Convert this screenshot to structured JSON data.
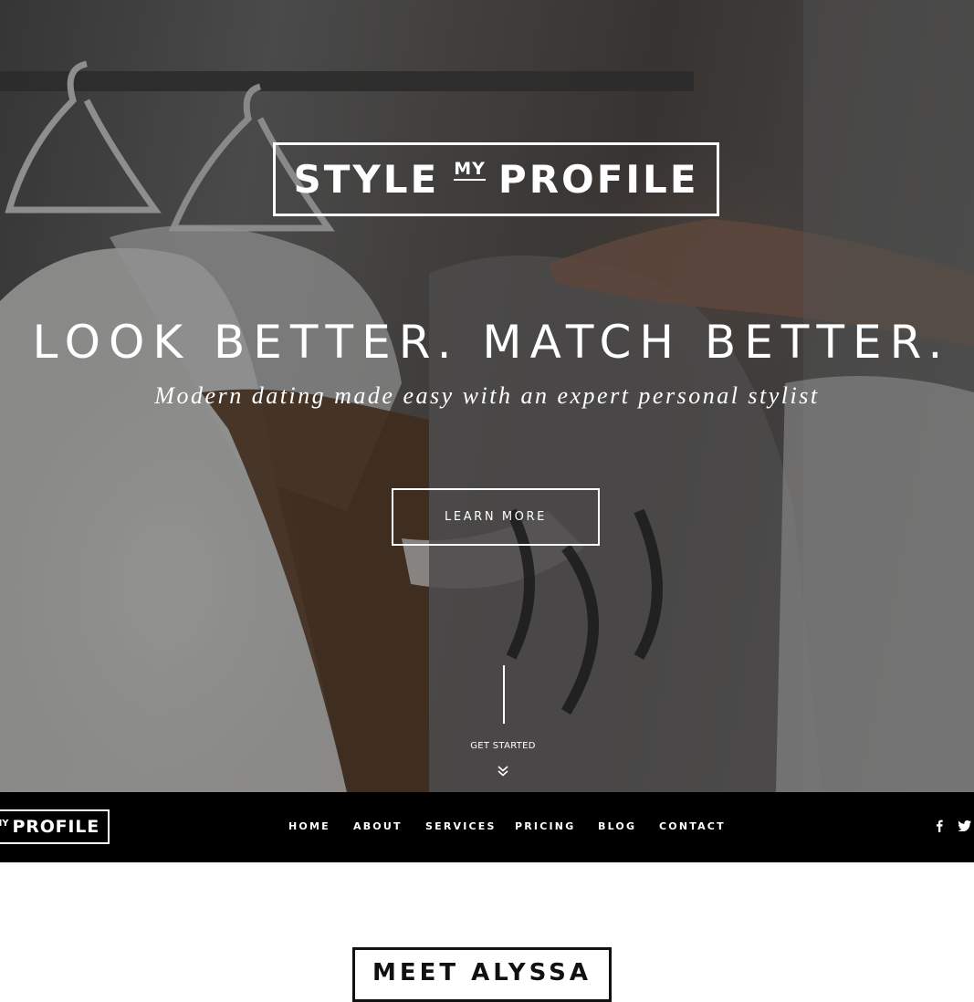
{
  "hero": {
    "logo": {
      "word1": "STYLE",
      "my": "MY",
      "word2": "PROFILE"
    },
    "headline": "LOOK BETTER. MATCH BETTER.",
    "subheadline": "Modern dating made easy with an expert personal stylist",
    "cta_label": "LEARN MORE",
    "scroll_label": "GET STARTED",
    "background_image": "clothing-rack-hangers"
  },
  "navbar": {
    "logo": {
      "my": "MY",
      "word": "PROFILE"
    },
    "links": [
      "HOME",
      "ABOUT",
      "SERVICES",
      "PRICING",
      "BLOG",
      "CONTACT"
    ],
    "social": {
      "facebook": "f",
      "twitter": "t"
    }
  },
  "about": {
    "heading": "MEET ALYSSA"
  },
  "colors": {
    "nav_background": "#000000",
    "text_on_dark": "#ffffff",
    "heading_border": "#111111"
  }
}
